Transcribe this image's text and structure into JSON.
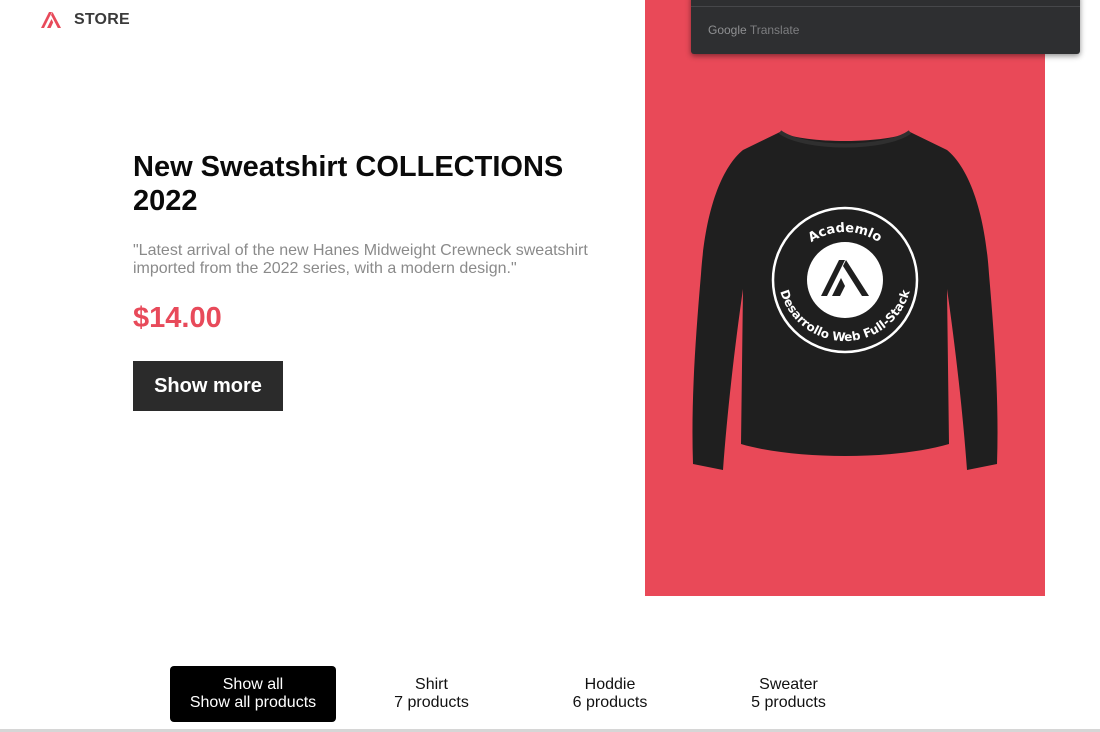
{
  "header": {
    "brand": "STORE",
    "logo_icon": "academlo-a-logo",
    "accent_color": "#e84a5a"
  },
  "hero": {
    "title": "New Sweatshirt COLLECTIONS 2022",
    "description": "\"Latest arrival of the new Hanes Midweight Crewneck sweatshirt imported from the 2022 series, with a modern design.\"",
    "price": "$14.00",
    "button_label": "Show more",
    "image_bg": "#e94958",
    "product_image": {
      "icon": "black-sweatshirt-image",
      "badge_top_text": "Academlo",
      "badge_bottom_text": "Desarrollo Web Full-Stack"
    }
  },
  "translate_popup": {
    "label_google": "Google",
    "label_translate": "Translate"
  },
  "filters": [
    {
      "name": "Show all",
      "count": "Show all products",
      "active": true
    },
    {
      "name": "Shirt",
      "count": "7 products",
      "active": false
    },
    {
      "name": "Hoddie",
      "count": "6 products",
      "active": false
    },
    {
      "name": "Sweater",
      "count": "5 products",
      "active": false
    }
  ]
}
